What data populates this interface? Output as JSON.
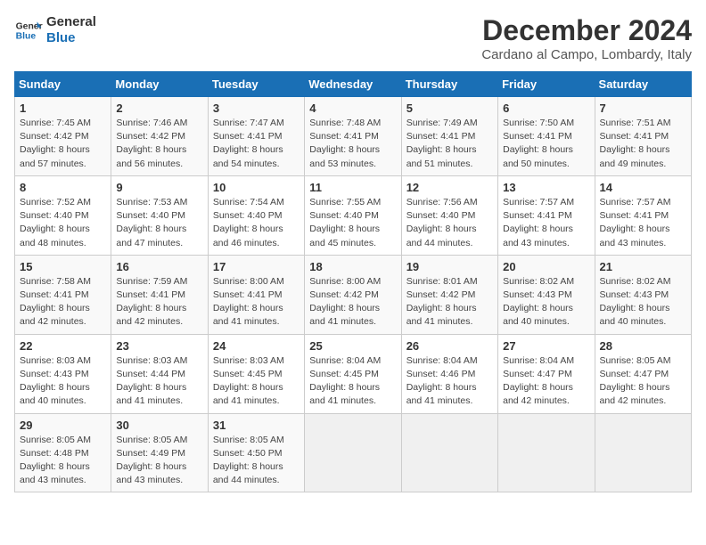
{
  "logo": {
    "text_general": "General",
    "text_blue": "Blue"
  },
  "title": "December 2024",
  "subtitle": "Cardano al Campo, Lombardy, Italy",
  "header": {
    "colors": {
      "accent": "#1a6fb5"
    }
  },
  "weekdays": [
    "Sunday",
    "Monday",
    "Tuesday",
    "Wednesday",
    "Thursday",
    "Friday",
    "Saturday"
  ],
  "weeks": [
    [
      {
        "day": "1",
        "sunrise": "Sunrise: 7:45 AM",
        "sunset": "Sunset: 4:42 PM",
        "daylight": "Daylight: 8 hours and 57 minutes."
      },
      {
        "day": "2",
        "sunrise": "Sunrise: 7:46 AM",
        "sunset": "Sunset: 4:42 PM",
        "daylight": "Daylight: 8 hours and 56 minutes."
      },
      {
        "day": "3",
        "sunrise": "Sunrise: 7:47 AM",
        "sunset": "Sunset: 4:41 PM",
        "daylight": "Daylight: 8 hours and 54 minutes."
      },
      {
        "day": "4",
        "sunrise": "Sunrise: 7:48 AM",
        "sunset": "Sunset: 4:41 PM",
        "daylight": "Daylight: 8 hours and 53 minutes."
      },
      {
        "day": "5",
        "sunrise": "Sunrise: 7:49 AM",
        "sunset": "Sunset: 4:41 PM",
        "daylight": "Daylight: 8 hours and 51 minutes."
      },
      {
        "day": "6",
        "sunrise": "Sunrise: 7:50 AM",
        "sunset": "Sunset: 4:41 PM",
        "daylight": "Daylight: 8 hours and 50 minutes."
      },
      {
        "day": "7",
        "sunrise": "Sunrise: 7:51 AM",
        "sunset": "Sunset: 4:41 PM",
        "daylight": "Daylight: 8 hours and 49 minutes."
      }
    ],
    [
      {
        "day": "8",
        "sunrise": "Sunrise: 7:52 AM",
        "sunset": "Sunset: 4:40 PM",
        "daylight": "Daylight: 8 hours and 48 minutes."
      },
      {
        "day": "9",
        "sunrise": "Sunrise: 7:53 AM",
        "sunset": "Sunset: 4:40 PM",
        "daylight": "Daylight: 8 hours and 47 minutes."
      },
      {
        "day": "10",
        "sunrise": "Sunrise: 7:54 AM",
        "sunset": "Sunset: 4:40 PM",
        "daylight": "Daylight: 8 hours and 46 minutes."
      },
      {
        "day": "11",
        "sunrise": "Sunrise: 7:55 AM",
        "sunset": "Sunset: 4:40 PM",
        "daylight": "Daylight: 8 hours and 45 minutes."
      },
      {
        "day": "12",
        "sunrise": "Sunrise: 7:56 AM",
        "sunset": "Sunset: 4:40 PM",
        "daylight": "Daylight: 8 hours and 44 minutes."
      },
      {
        "day": "13",
        "sunrise": "Sunrise: 7:57 AM",
        "sunset": "Sunset: 4:41 PM",
        "daylight": "Daylight: 8 hours and 43 minutes."
      },
      {
        "day": "14",
        "sunrise": "Sunrise: 7:57 AM",
        "sunset": "Sunset: 4:41 PM",
        "daylight": "Daylight: 8 hours and 43 minutes."
      }
    ],
    [
      {
        "day": "15",
        "sunrise": "Sunrise: 7:58 AM",
        "sunset": "Sunset: 4:41 PM",
        "daylight": "Daylight: 8 hours and 42 minutes."
      },
      {
        "day": "16",
        "sunrise": "Sunrise: 7:59 AM",
        "sunset": "Sunset: 4:41 PM",
        "daylight": "Daylight: 8 hours and 42 minutes."
      },
      {
        "day": "17",
        "sunrise": "Sunrise: 8:00 AM",
        "sunset": "Sunset: 4:41 PM",
        "daylight": "Daylight: 8 hours and 41 minutes."
      },
      {
        "day": "18",
        "sunrise": "Sunrise: 8:00 AM",
        "sunset": "Sunset: 4:42 PM",
        "daylight": "Daylight: 8 hours and 41 minutes."
      },
      {
        "day": "19",
        "sunrise": "Sunrise: 8:01 AM",
        "sunset": "Sunset: 4:42 PM",
        "daylight": "Daylight: 8 hours and 41 minutes."
      },
      {
        "day": "20",
        "sunrise": "Sunrise: 8:02 AM",
        "sunset": "Sunset: 4:43 PM",
        "daylight": "Daylight: 8 hours and 40 minutes."
      },
      {
        "day": "21",
        "sunrise": "Sunrise: 8:02 AM",
        "sunset": "Sunset: 4:43 PM",
        "daylight": "Daylight: 8 hours and 40 minutes."
      }
    ],
    [
      {
        "day": "22",
        "sunrise": "Sunrise: 8:03 AM",
        "sunset": "Sunset: 4:43 PM",
        "daylight": "Daylight: 8 hours and 40 minutes."
      },
      {
        "day": "23",
        "sunrise": "Sunrise: 8:03 AM",
        "sunset": "Sunset: 4:44 PM",
        "daylight": "Daylight: 8 hours and 41 minutes."
      },
      {
        "day": "24",
        "sunrise": "Sunrise: 8:03 AM",
        "sunset": "Sunset: 4:45 PM",
        "daylight": "Daylight: 8 hours and 41 minutes."
      },
      {
        "day": "25",
        "sunrise": "Sunrise: 8:04 AM",
        "sunset": "Sunset: 4:45 PM",
        "daylight": "Daylight: 8 hours and 41 minutes."
      },
      {
        "day": "26",
        "sunrise": "Sunrise: 8:04 AM",
        "sunset": "Sunset: 4:46 PM",
        "daylight": "Daylight: 8 hours and 41 minutes."
      },
      {
        "day": "27",
        "sunrise": "Sunrise: 8:04 AM",
        "sunset": "Sunset: 4:47 PM",
        "daylight": "Daylight: 8 hours and 42 minutes."
      },
      {
        "day": "28",
        "sunrise": "Sunrise: 8:05 AM",
        "sunset": "Sunset: 4:47 PM",
        "daylight": "Daylight: 8 hours and 42 minutes."
      }
    ],
    [
      {
        "day": "29",
        "sunrise": "Sunrise: 8:05 AM",
        "sunset": "Sunset: 4:48 PM",
        "daylight": "Daylight: 8 hours and 43 minutes."
      },
      {
        "day": "30",
        "sunrise": "Sunrise: 8:05 AM",
        "sunset": "Sunset: 4:49 PM",
        "daylight": "Daylight: 8 hours and 43 minutes."
      },
      {
        "day": "31",
        "sunrise": "Sunrise: 8:05 AM",
        "sunset": "Sunset: 4:50 PM",
        "daylight": "Daylight: 8 hours and 44 minutes."
      },
      null,
      null,
      null,
      null
    ]
  ]
}
